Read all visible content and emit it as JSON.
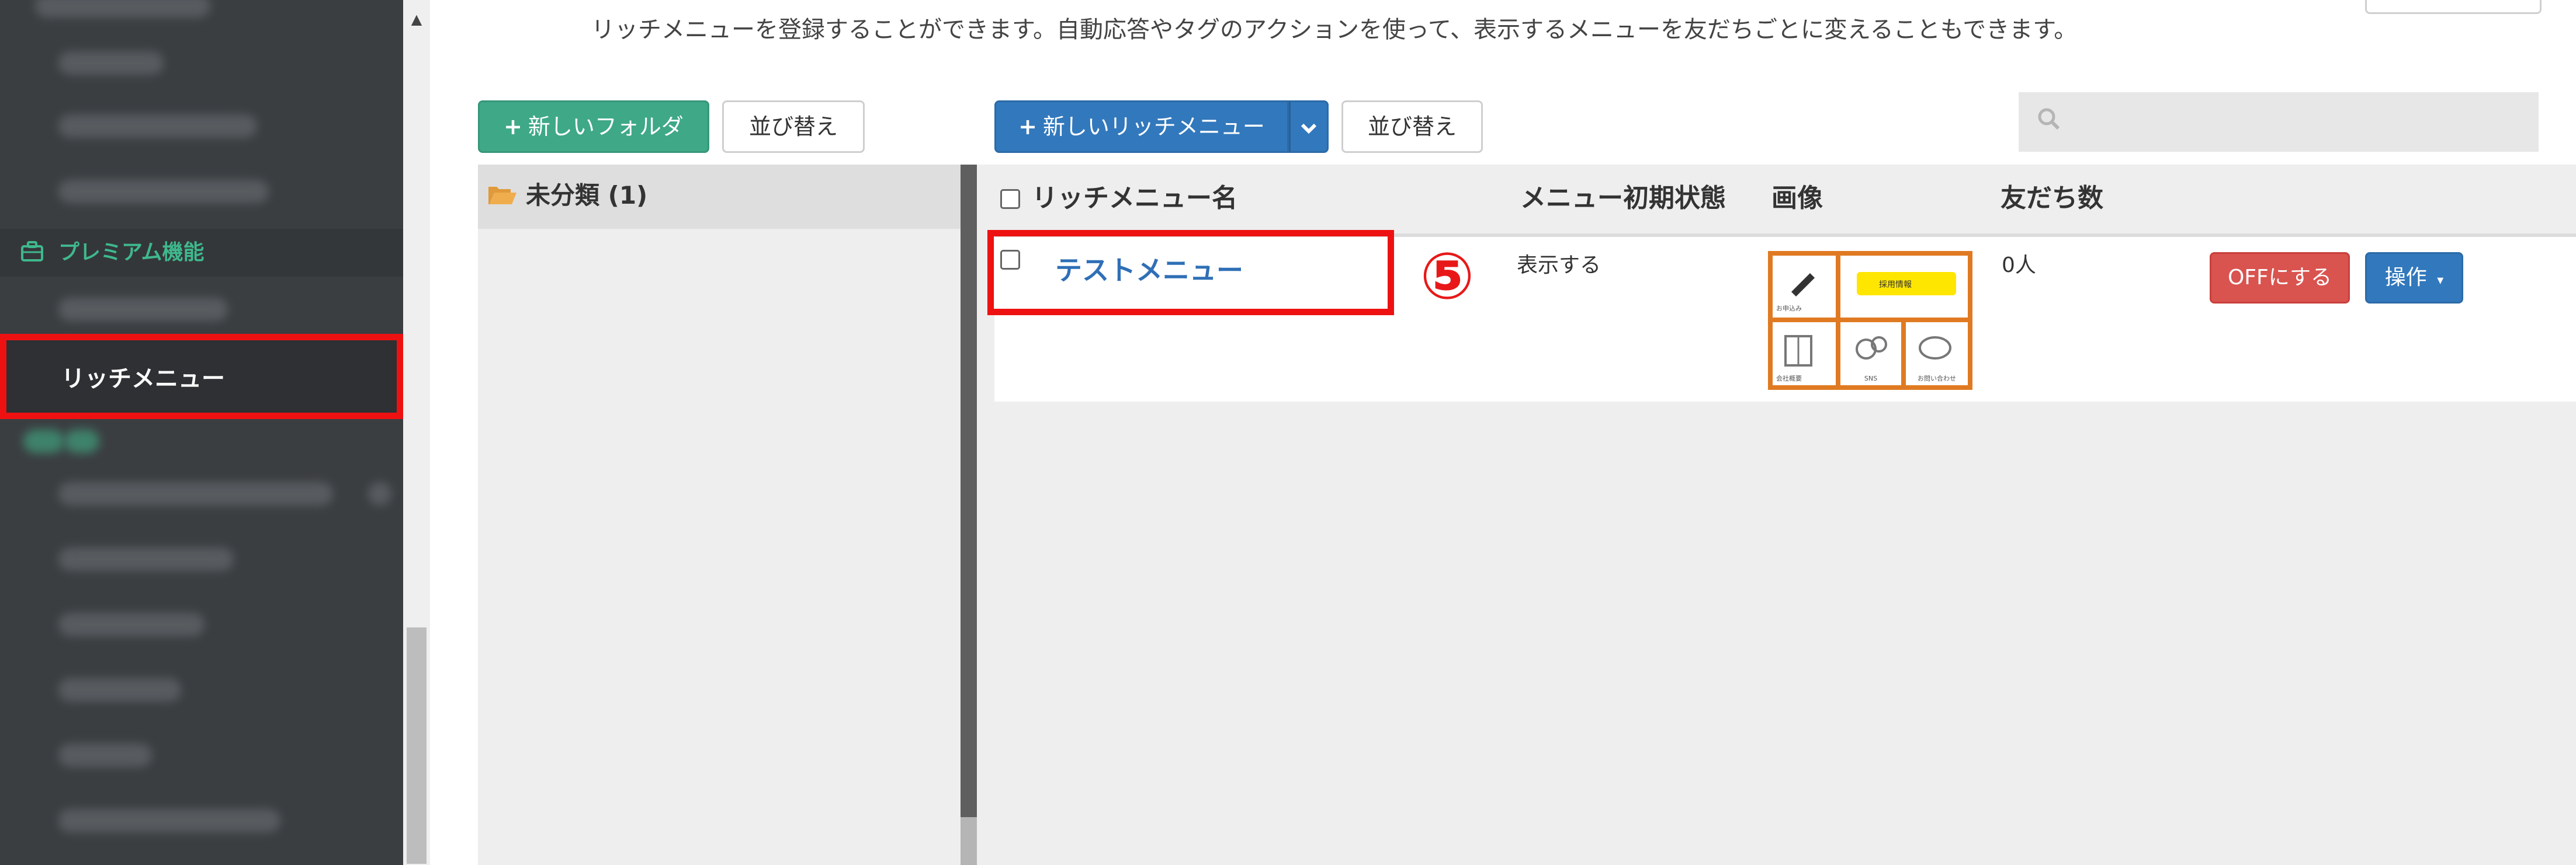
{
  "description": "リッチメニューを登録することができます。自動応答やタグのアクションを使って、表示するメニューを友だちごとに変えることもできます。",
  "sidebar": {
    "section_label": "プレミアム機能",
    "active_item_label": "リッチメニュー"
  },
  "toolbar": {
    "new_folder_label": "新しいフォルダ",
    "sort_folders_label": "並び替え",
    "new_richmenu_label": "新しいリッチメニュー",
    "sort_menus_label": "並び替え"
  },
  "folders": [
    {
      "label": "未分類 (1)"
    }
  ],
  "table": {
    "headers": {
      "name": "リッチメニュー名",
      "initial_state": "メニュー初期状態",
      "image": "画像",
      "friends": "友だち数"
    },
    "rows": [
      {
        "name": "テストメニュー",
        "initial_state": "表示する",
        "friends": "0人",
        "off_button": "OFFにする",
        "action_button": "操作"
      }
    ]
  },
  "annotation": {
    "step": "⑤"
  },
  "thumbnail": {
    "cells": [
      "お申込み",
      "採用情報",
      "会社概要",
      "SNS",
      "お問い合わせ"
    ],
    "border_color": "#e07a22",
    "banner_color": "#ffe600"
  },
  "colors": {
    "sidebar_bg": "#3b3e41",
    "accent_green": "#3ea887",
    "primary_blue": "#3278bc",
    "danger_red": "#d9534f",
    "highlight_red": "#ee1111",
    "link_blue": "#2f6fb6"
  }
}
